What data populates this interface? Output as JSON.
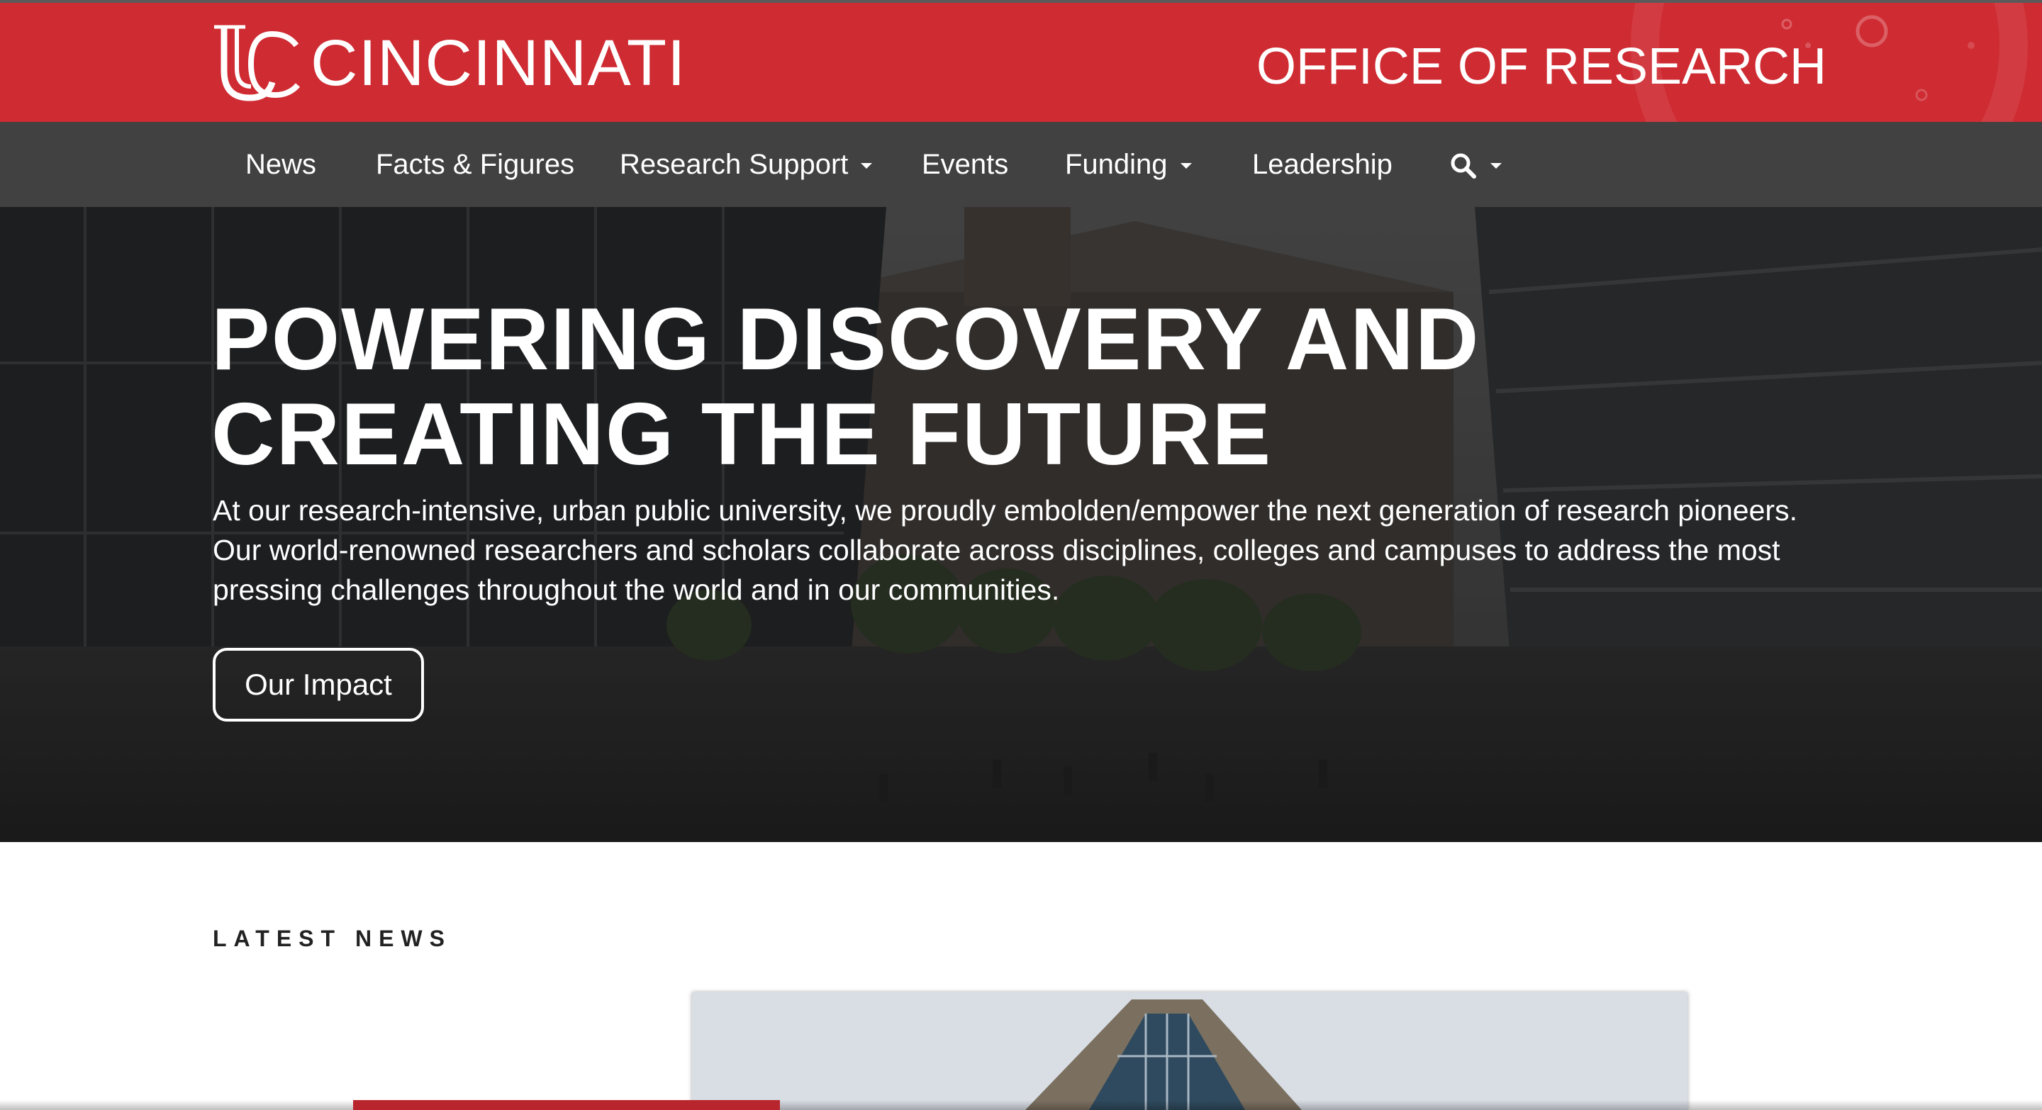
{
  "header": {
    "logo_text": "CINCINNATI",
    "logo_icon": "uc-monogram-icon",
    "office_title": "OFFICE OF RESEARCH",
    "brand_color": "#cf2b32"
  },
  "nav": {
    "items": [
      {
        "label": "News"
      },
      {
        "label": "Facts & Figures"
      },
      {
        "label": "Research Support",
        "dropdown": true
      },
      {
        "label": "Events"
      },
      {
        "label": "Funding",
        "dropdown": true
      },
      {
        "label": "Leadership"
      }
    ],
    "search_icon": "search-icon",
    "background": "#414141"
  },
  "hero": {
    "title_line1": "POWERING DISCOVERY AND",
    "title_line2": "CREATING THE FUTURE",
    "text": "At our research-intensive, urban public university, we proudly embolden/empower the next generation of research pioneers. Our world-renowned researchers and scholars collaborate across disciplines, colleges and campuses to address the most pressing challenges throughout the world and in our communities.",
    "button_label": "Our Impact"
  },
  "news": {
    "heading": "LATEST NEWS"
  }
}
